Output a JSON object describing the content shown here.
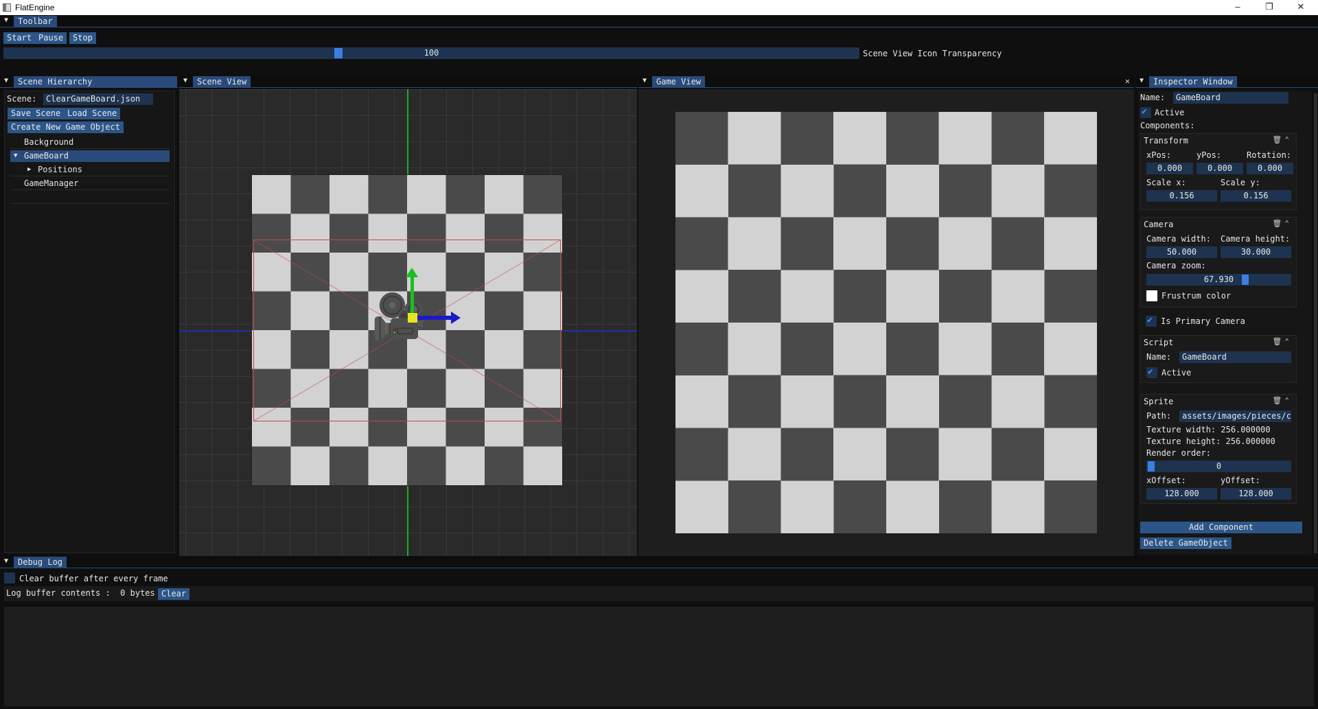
{
  "window": {
    "title": "FlatEngine"
  },
  "toolbar": {
    "tab": "Toolbar",
    "start_label": "Start",
    "pause_label": "Pause",
    "stop_label": "Stop",
    "slider_value": "100",
    "slider_fraction": 0.39,
    "slider_label": "Scene View Icon Transparency"
  },
  "hierarchy": {
    "tab": "Scene Hierarchy",
    "scene_label": "Scene:",
    "scene_file": "ClearGameBoard.json",
    "save_label": "Save Scene",
    "load_label": "Load Scene",
    "create_label": "Create New Game Object",
    "items": [
      "Background",
      "GameBoard",
      "Positions",
      "GameManager"
    ]
  },
  "scene_view": {
    "tab": "Scene View"
  },
  "game_view": {
    "tab": "Game View",
    "close_glyph": "✕"
  },
  "inspector": {
    "tab": "Inspector Window",
    "name_label": "Name:",
    "name_value": "GameBoard",
    "active_label": "Active",
    "components_label": "Components:",
    "transform": {
      "title": "Transform",
      "xpos_label": "xPos:",
      "ypos_label": "yPos:",
      "rotation_label": "Rotation:",
      "xpos": "0.000",
      "ypos": "0.000",
      "rotation": "0.000",
      "scalex_label": "Scale x:",
      "scaley_label": "Scale y:",
      "scalex": "0.156",
      "scaley": "0.156"
    },
    "camera": {
      "title": "Camera",
      "width_label": "Camera width:",
      "height_label": "Camera height:",
      "width": "50.000",
      "height": "30.000",
      "zoom_label": "Camera zoom:",
      "zoom": "67.930",
      "frustum_label": "Frustrum color",
      "primary_label": "Is Primary Camera"
    },
    "script": {
      "title": "Script",
      "name_label": "Name:",
      "name_value": "GameBoard",
      "active_label": "Active"
    },
    "sprite": {
      "title": "Sprite",
      "path_label": "Path:",
      "path_value": "assets/images/pieces/ch",
      "tex_width": "Texture width: 256.000000",
      "tex_height": "Texture height: 256.000000",
      "render_order_label": "Render order:",
      "render_order": "0",
      "xoffset_label": "xOffset:",
      "yoffset_label": "yOffset:",
      "xoffset": "128.000",
      "yoffset": "128.000"
    },
    "add_component_label": "Add Component",
    "delete_label": "Delete GameObject"
  },
  "debug": {
    "tab": "Debug Log",
    "clear_buffer_label": "Clear buffer after every frame",
    "buffer_text": "Log buffer contents :  0 bytes",
    "clear_label": "Clear"
  },
  "colors": {
    "accent": "#2c5689",
    "panel_tab": "#294a7a",
    "field": "#1d3350",
    "check": "#4d8ff0"
  }
}
